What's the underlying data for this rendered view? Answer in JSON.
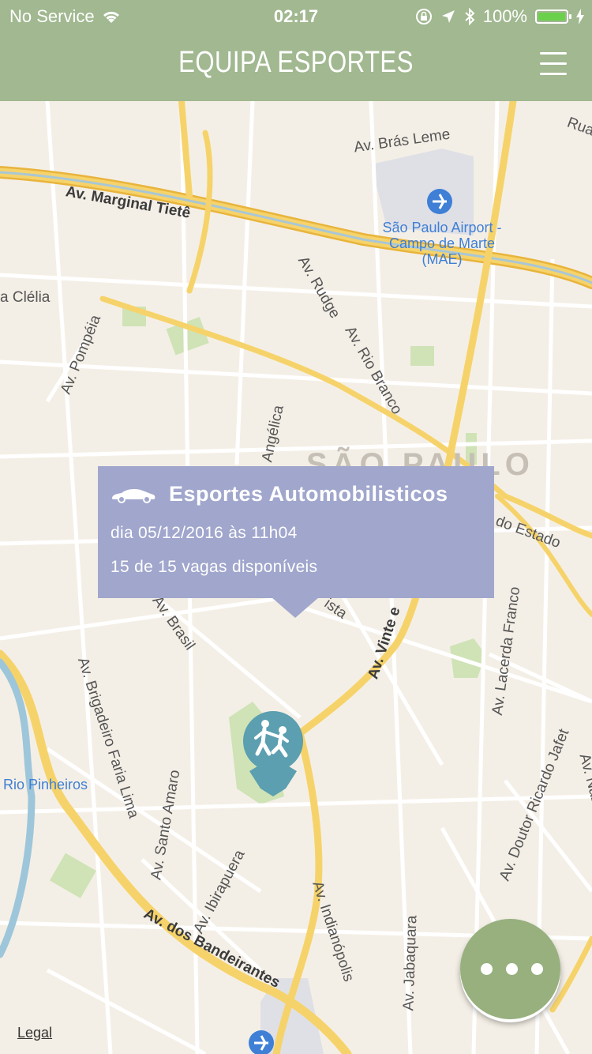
{
  "status_bar": {
    "carrier": "No Service",
    "time": "02:17",
    "battery": "100%"
  },
  "nav": {
    "title": "EQUIPA ESPORTES"
  },
  "map": {
    "labels": {
      "bras_leme": "Av. Brás Leme",
      "rua": "Rua",
      "marginal": "Av. Marginal Tietê",
      "airport": "São Paulo Airport - Campo de Marte (MAE)",
      "clelia": "a Clélia",
      "pompeia": "Av. Pompéia",
      "rudge": "Av. Rudge",
      "rio_branco": "Av. Rio Branco",
      "angelica": "Angélica",
      "city": "SÃO PAULO",
      "do_estado": "do Estado",
      "brasil": "Av. Brasil",
      "ista": "ista",
      "vinte": "Av. Vinte e",
      "lacerda": "Av. Lacerda Franco",
      "brigadeiro": "Av. Brigadeiro Faria Lima",
      "rio_pinheiros": "Rio Pinheiros",
      "santo_amaro": "Av. Santo Amaro",
      "ricardo_jafet": "Av. Doutor Ricardo Jafet",
      "nazare": "Av. Nazaré",
      "ibirapuera": "Av. Ibirapuera",
      "indianopolis": "Av. Indianópolis",
      "bandeirantes": "Av. dos Bandeirantes",
      "jabaquara": "Av. Jabaquara"
    },
    "legal": "Legal"
  },
  "callout": {
    "title": "Esportes Automobilisticos",
    "date_line": "dia 05/12/2016 às 11h04",
    "vacancy_line": "15 de 15 vagas disponíveis",
    "icon": "car-icon"
  },
  "pin": {
    "icon": "martial-arts-icon",
    "color": "#5b9fb0"
  },
  "fab": {
    "icon": "more-dots-icon",
    "color": "#97b07e"
  },
  "colors": {
    "header": "#a1b890",
    "callout": "#a0a6cc",
    "map_bg": "#f4efe6",
    "highway": "#f6c84a",
    "park": "#cfe3b6"
  }
}
